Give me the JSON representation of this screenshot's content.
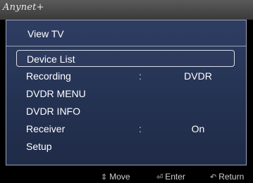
{
  "brand": {
    "logo_text": "Anynet+"
  },
  "menu": {
    "title": "View TV",
    "items": [
      {
        "label": "Device List",
        "value": "",
        "selected": true
      },
      {
        "label": "Recording",
        "value": "DVDR",
        "separator": ":"
      },
      {
        "label": "DVDR MENU",
        "value": ""
      },
      {
        "label": "DVDR INFO",
        "value": ""
      },
      {
        "label": "Receiver",
        "value": "On",
        "separator": ":"
      },
      {
        "label": "Setup",
        "value": ""
      }
    ]
  },
  "footer": {
    "move_label": "Move",
    "enter_label": "Enter",
    "return_label": "Return",
    "move_icon": "up-down-arrows-icon",
    "enter_icon": "enter-icon",
    "return_icon": "return-icon"
  },
  "colors": {
    "panel": "#253354",
    "border": "#9aa3b8",
    "text": "#ffffff"
  }
}
